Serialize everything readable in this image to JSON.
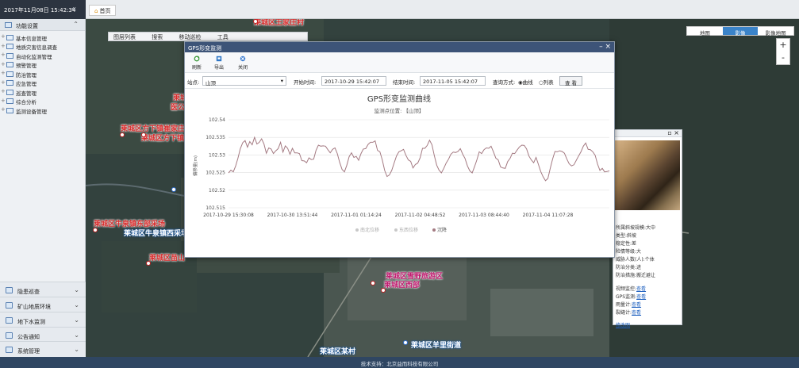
{
  "topbar": {
    "datetime": "2017年11月08日 15:42:34",
    "collapse_icon": "double-chevron-left",
    "home_tab": "首页"
  },
  "sidebar": {
    "header": "功能设置",
    "items": [
      {
        "label": "基本信息管理",
        "expand": "+"
      },
      {
        "label": "地质灾害信息调查",
        "expand": "+"
      },
      {
        "label": "自动化监测管理",
        "expand": "+"
      },
      {
        "label": "预警管理",
        "expand": "+"
      },
      {
        "label": "防治管理",
        "expand": "+"
      },
      {
        "label": "应急管理",
        "expand": "+"
      },
      {
        "label": "巡查管理",
        "expand": "+"
      },
      {
        "label": "综合分析",
        "expand": "+"
      },
      {
        "label": "监测设备管理",
        "expand": "+"
      }
    ],
    "bottom": [
      {
        "label": "隐患巡查"
      },
      {
        "label": "矿山地质环境"
      },
      {
        "label": "地下水监测"
      },
      {
        "label": "公告通知"
      },
      {
        "label": "系统管理"
      }
    ]
  },
  "map": {
    "toolbar": [
      "图层列表",
      "搜索",
      "移动巡检",
      "工具"
    ],
    "map_types": [
      {
        "label": "地图",
        "active": false
      },
      {
        "label": "影像",
        "active": true
      },
      {
        "label": "影像地图",
        "active": false
      }
    ],
    "zoom_in": "+",
    "zoom_out": "-",
    "labels": [
      {
        "text": "莱城区王家庄村",
        "style": "red"
      },
      {
        "text": "莱城",
        "style": "red"
      },
      {
        "text": "医公",
        "style": "red"
      },
      {
        "text": "莱城区方下镇崔家庄",
        "style": "red"
      },
      {
        "text": "莱城区方下镇",
        "style": "red"
      },
      {
        "text": "莱城区牛泉镇东部采场",
        "style": "red"
      },
      {
        "text": "莱城区牛泉镇西采场",
        "style": "blue"
      },
      {
        "text": "莱城区苗山",
        "style": "red"
      },
      {
        "text": "莱城区雪野旅游区",
        "style": "pink"
      },
      {
        "text": "莱城区西部",
        "style": "pink"
      },
      {
        "text": "莱城区羊里街道",
        "style": "blue"
      },
      {
        "text": "莱城区某村",
        "style": "blue"
      }
    ]
  },
  "info_panel": {
    "lines": [
      "所属斜坡规模:大中",
      "类型:斜坡",
      "稳定性:差",
      "险情等级:大",
      "威胁人数(人):个体",
      "防治分类:进",
      "防治措施:搬迁避让"
    ],
    "links": [
      {
        "label": "视频监控",
        "link": "查看"
      },
      {
        "label": "GPS监测",
        "link": "查看"
      },
      {
        "label": "雨量计",
        "link": "查看"
      },
      {
        "label": "裂缝计",
        "link": "查看"
      }
    ],
    "bottom_link": "修改图"
  },
  "dialog": {
    "title": "GPS形变监测",
    "tools": [
      {
        "label": "刷新",
        "icon": "refresh-icon"
      },
      {
        "label": "导出",
        "icon": "export-icon"
      },
      {
        "label": "关闭",
        "icon": "close-icon"
      }
    ],
    "filter": {
      "site_label": "站点:",
      "site_value": "山顶",
      "start_label": "开始时间:",
      "start_value": "2017-10-29 15:42:07",
      "end_label": "结束时间:",
      "end_value": "2017-11-05 15:42:07",
      "query_label": "查询方式:",
      "mode_curve": "曲线",
      "mode_table": "列表",
      "search_button": "查 看"
    }
  },
  "chart_data": {
    "type": "line",
    "title": "GPS形变监测曲线",
    "subtitle": "监测点位置: 【山顶】",
    "ylabel": "偏移量(m)",
    "ylim": [
      102.515,
      102.54
    ],
    "yticks": [
      102.54,
      102.535,
      102.53,
      102.525,
      102.52,
      102.515
    ],
    "xtick_labels": [
      "2017-10-29 15:30:08",
      "2017-10-30 13:51:44",
      "2017-11-01 01:14:24",
      "2017-11-02 04:48:52",
      "2017-11-03 08:44:40",
      "2017-11-04 11:07:28"
    ],
    "legend": [
      "南北位移",
      "东西位移",
      "沉降"
    ],
    "series": [
      {
        "name": "沉降",
        "color": "#a47a82",
        "values": [
          102.5249,
          102.5257,
          102.5252,
          102.5268,
          102.5291,
          102.5318,
          102.5335,
          102.5341,
          102.5322,
          102.5338,
          102.5329,
          102.535,
          102.5331,
          102.5336,
          102.5346,
          102.5331,
          102.5305,
          102.532,
          102.5317,
          102.5304,
          102.5312,
          102.5318,
          102.5336,
          102.5308,
          102.5326,
          102.5319,
          102.5302,
          102.5319,
          102.5306,
          102.5306,
          102.5304,
          102.5284,
          102.5283,
          102.5278,
          102.5292,
          102.5287,
          102.5288,
          102.5313,
          102.5328,
          102.5325,
          102.5326,
          102.5325,
          102.5315,
          102.5306,
          102.5316,
          102.532,
          102.5304,
          102.5279,
          102.5259,
          102.5252,
          102.5271,
          102.5295,
          102.5306,
          102.5293,
          102.5296,
          102.5285,
          102.5304,
          102.5317,
          102.5318,
          102.533,
          102.5336,
          102.5336,
          102.534,
          102.5313,
          102.5309,
          102.5286,
          102.5256,
          102.5239,
          102.5243,
          102.5256,
          102.5277,
          102.5297,
          102.5309,
          102.5312,
          102.5316,
          102.5299,
          102.5286,
          102.5282,
          102.5263,
          102.5273,
          102.5277,
          102.5292,
          102.5319,
          102.5319,
          102.5327,
          102.5342,
          102.5329,
          102.5298,
          102.5271,
          102.5257,
          102.5249,
          102.5262,
          102.5277,
          102.5288,
          102.5302,
          102.5308,
          102.5307,
          102.531,
          102.5318,
          102.5302,
          102.529,
          102.5269,
          102.5255,
          102.5249,
          102.5267,
          102.5286,
          102.5309,
          102.5304,
          102.5315,
          102.532,
          102.5319,
          102.5325,
          102.5309,
          102.5291,
          102.5286,
          102.5266,
          102.5263,
          102.5262,
          102.5281,
          102.529,
          102.5305,
          102.5304,
          102.5314,
          102.5323,
          102.5328,
          102.5327,
          102.5317,
          102.5297,
          102.5286,
          102.5278,
          102.5293,
          102.5273,
          102.5253,
          102.5238,
          102.5227,
          102.5233,
          102.5262,
          102.5288,
          102.531,
          102.5309,
          102.5312,
          102.531,
          102.5305,
          102.5289,
          102.5275,
          102.5269,
          102.5272,
          102.5285,
          102.5297,
          102.5309,
          102.5325,
          102.5334,
          102.5316,
          102.5315,
          102.5309,
          102.5299,
          102.5274,
          102.5256,
          102.5262,
          102.5252,
          102.5253,
          102.5255
        ]
      }
    ]
  },
  "footer": {
    "text": "技术支持：北京益而科技有限公司"
  }
}
